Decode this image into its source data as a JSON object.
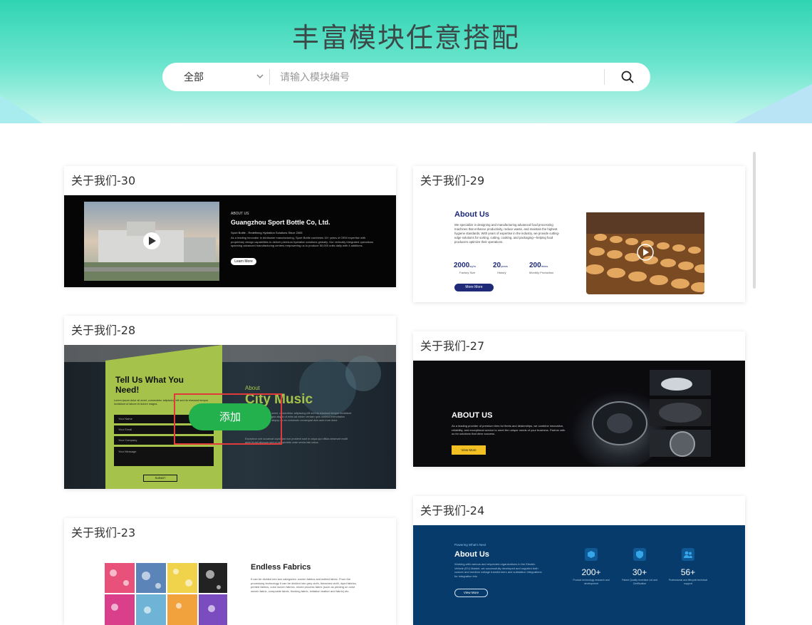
{
  "hero": {
    "title": "丰富模块任意搭配"
  },
  "search": {
    "category": "全部",
    "placeholder": "请输入模块编号"
  },
  "add_button": "添加",
  "cards": {
    "c30": {
      "title": "关于我们-30",
      "label": "ABOUT US",
      "heading": "Guangzhou Sport Bottle Co, Ltd.",
      "sub": "Sport Bottle - Redefining Hydration Solutions Since 2005",
      "body": "As a leading innovator in drinkware manufacturing, Sport Bottle combines 15+ years of OEM expertise with proprietary design capabilities to deliver premium hydration solutions globally. Our vertically integrated operations spanning advanced manufacturing centers empowering us to produce 50,000 units daily with 4 additions.",
      "button": "Learn More"
    },
    "c29": {
      "title": "关于我们-29",
      "heading": "About Us",
      "body": "We specialize in designing and manufacturing advanced food processing machines that enhance productivity, reduce waste, and maintain the highest hygiene standards. With years of expertise in the industry, we provide cutting-edge solutions for sorting, cutting, cooking, and packaging—helping food producers optimize their operations.",
      "stats": [
        {
          "value": "2000",
          "unit": "sq/m",
          "label": "Factory Size"
        },
        {
          "value": "20",
          "unit": "years",
          "label": "History"
        },
        {
          "value": "200",
          "unit": "items",
          "label": "Monthly Production"
        }
      ],
      "button": "More More"
    },
    "c28": {
      "title": "关于我们-28",
      "form_heading": "Tell Us What You Need!",
      "form_text": "Lorem ipsum dolor sit amet, consectetur adipiscing elit sed do eiusmod tempor incididunt ut labore et dolore magna.",
      "fields": [
        "Your Name",
        "Your Email",
        "Your Company",
        "Your Message"
      ],
      "submit": "SUBMIT",
      "about_label": "About",
      "about_heading": "City Music",
      "about_body": "Lorem ipsum dolor sit amet, consectetur adipiscing elit sed do eiusmod tempor incididunt ut labore et dolore magna aliqua ut enim ad minim veniam quis nostrud exercitation ullamco laboris nisi ut aliquip ex ea commodo consequat duis aute irure dolor.",
      "about_body2": "Excepteur sint occaecat cupidatat non proident sunt in culpa qui officia deserunt mollit anim id est laborum sed ut perspiciatis unde omnis iste natus."
    },
    "c27": {
      "title": "关于我们-27",
      "heading": "ABOUT US",
      "body": "As a leading provider of premium tires for fleets and dealerships, we combine innovation, reliability, and exceptional service to meet the unique needs of your business. Partner with us for solutions that drive success.",
      "button": "View More"
    },
    "c24": {
      "title": "关于我们-24",
      "label": "Powering What's Next",
      "heading": "About Us",
      "body": "Working with various and respected organizations in the Electric Vehicle (EV) Market, we successfully developed and supplied both custom and medium voltage transformers and substation integrations for integration into",
      "button": "View More",
      "stats": [
        {
          "value": "200+",
          "label": "Product technology research and development"
        },
        {
          "value": "30+",
          "label": "Patent Quality Invention Ltd and Certification"
        },
        {
          "value": "56+",
          "label": "Professional and lifecycle technical support"
        }
      ]
    },
    "c23": {
      "title": "关于我们-23",
      "heading": "Endless Fabrics",
      "body": "It can be divided into two categories: woven fabrics and knitted fabric. From the processing technology it can be divided into grey cloth, bleached cloth, dyed fabrics, printed fabrics, color woven fabrics, mixed process fabric (such as printing on color woven fabric, composite fabric, flocking fabric, imitation leather and fabric) etc."
    }
  },
  "colors": {
    "hero_top": "#2fd4b3",
    "add_green": "#22b14c",
    "highlight_red": "#e03a3a"
  }
}
